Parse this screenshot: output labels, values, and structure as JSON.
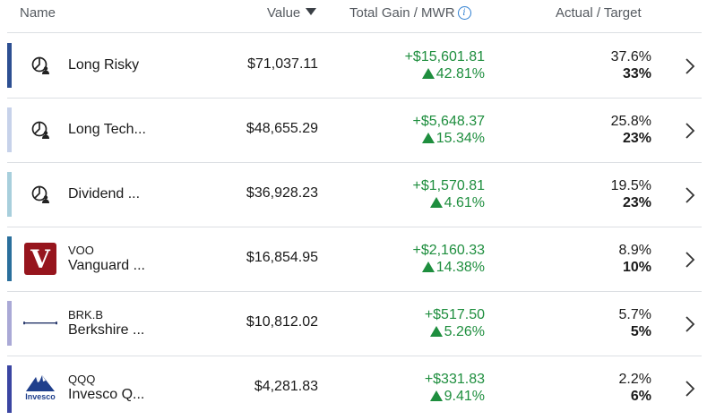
{
  "header": {
    "name": "Name",
    "value": "Value",
    "gain": "Total Gain / MWR",
    "info_glyph": "i",
    "actual_target": "Actual / Target"
  },
  "rows": [
    {
      "title": "Long Risky",
      "symbol": "",
      "value": "$71,037.11",
      "gain": "+$15,601.81",
      "pct": "42.81%",
      "actual": "37.6%",
      "target": "33%",
      "bar_color": "#2d4f92",
      "icon": "portfolio-icon"
    },
    {
      "title": "Long Tech...",
      "symbol": "",
      "value": "$48,655.29",
      "gain": "+$5,648.37",
      "pct": "15.34%",
      "actual": "25.8%",
      "target": "23%",
      "bar_color": "#c7d2ea",
      "icon": "portfolio-icon"
    },
    {
      "title": "Dividend ...",
      "symbol": "",
      "value": "$36,928.23",
      "gain": "+$1,570.81",
      "pct": "4.61%",
      "actual": "19.5%",
      "target": "23%",
      "bar_color": "#a8cfdc",
      "icon": "portfolio-icon"
    },
    {
      "title": "Vanguard ...",
      "symbol": "VOO",
      "value": "$16,854.95",
      "gain": "+$2,160.33",
      "pct": "14.38%",
      "actual": "8.9%",
      "target": "10%",
      "bar_color": "#2a6f9c",
      "icon": "vanguard-logo-icon",
      "logo_text": "V"
    },
    {
      "title": "Berkshire ...",
      "symbol": "BRK.B",
      "value": "$10,812.02",
      "gain": "+$517.50",
      "pct": "5.26%",
      "actual": "5.7%",
      "target": "5%",
      "bar_color": "#aaa9d6",
      "icon": "berkshire-logo-icon"
    },
    {
      "title": "Invesco Q...",
      "symbol": "QQQ",
      "value": "$4,281.83",
      "gain": "+$331.83",
      "pct": "9.41%",
      "actual": "2.2%",
      "target": "6%",
      "bar_color": "#3a45a2",
      "icon": "invesco-logo-icon",
      "logo_text": "Invesco"
    }
  ],
  "colors": {
    "gain_green": "#1e8e3e",
    "vanguard_red": "#96151d",
    "invesco_blue": "#1f3f8c"
  }
}
